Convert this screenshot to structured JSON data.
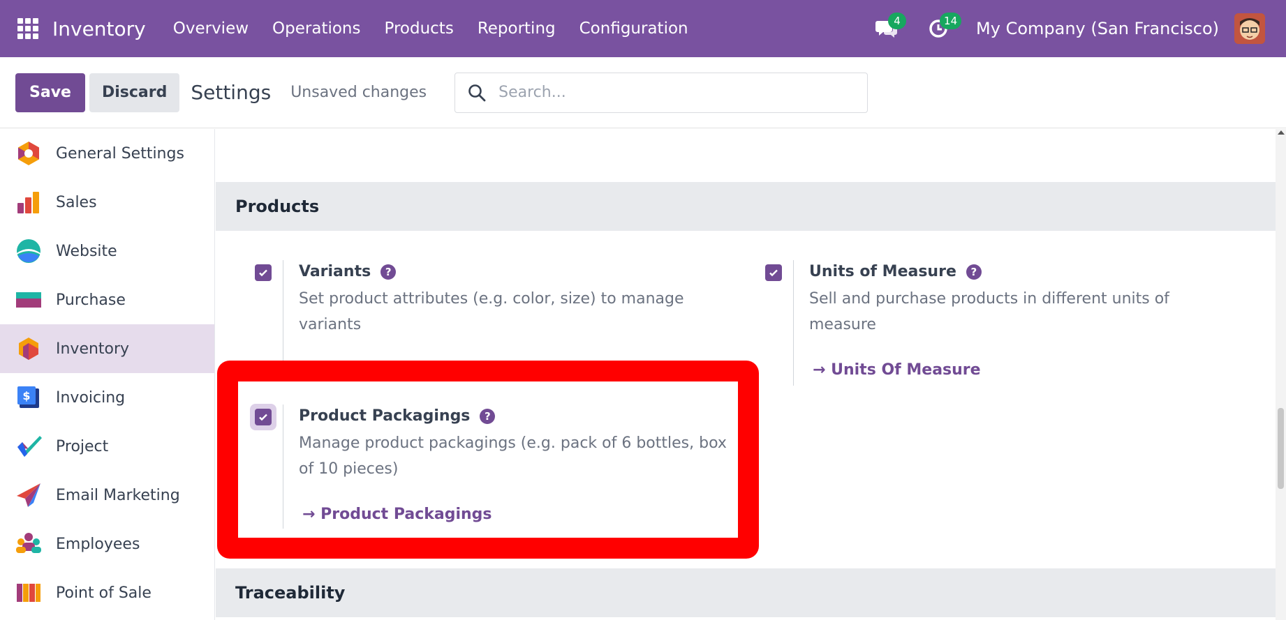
{
  "navbar": {
    "brand": "Inventory",
    "menu": [
      "Overview",
      "Operations",
      "Products",
      "Reporting",
      "Configuration"
    ],
    "messages_count": "4",
    "activities_count": "14",
    "company": "My Company (San Francisco)"
  },
  "control_panel": {
    "save_label": "Save",
    "discard_label": "Discard",
    "title": "Settings",
    "status": "Unsaved changes",
    "search_placeholder": "Search..."
  },
  "sidebar": {
    "items": [
      {
        "label": "General Settings",
        "icon": "general-settings-icon"
      },
      {
        "label": "Sales",
        "icon": "sales-icon"
      },
      {
        "label": "Website",
        "icon": "website-icon"
      },
      {
        "label": "Purchase",
        "icon": "purchase-icon"
      },
      {
        "label": "Inventory",
        "icon": "inventory-icon",
        "active": true
      },
      {
        "label": "Invoicing",
        "icon": "invoicing-icon"
      },
      {
        "label": "Project",
        "icon": "project-icon"
      },
      {
        "label": "Email Marketing",
        "icon": "email-marketing-icon"
      },
      {
        "label": "Employees",
        "icon": "employees-icon"
      },
      {
        "label": "Point of Sale",
        "icon": "point-of-sale-icon"
      }
    ]
  },
  "main": {
    "products_section": "Products",
    "traceability_section": "Traceability",
    "variants": {
      "title": "Variants",
      "desc_line1": "Set product attributes (e.g. color, size) to manage",
      "desc_line2": "variants",
      "checked": true
    },
    "uom": {
      "title": "Units of Measure",
      "desc_line1": "Sell and purchase products in different units of",
      "desc_line2": "measure",
      "link": "Units Of Measure",
      "checked": true
    },
    "packagings": {
      "title": "Product Packagings",
      "desc_line1": "Manage product packagings (e.g. pack of 6 bottles, box",
      "desc_line2": "of 10 pieces)",
      "link": "Product Packagings",
      "checked": true
    }
  },
  "colors": {
    "navbar": "#7952a0",
    "primary": "#714b94",
    "highlight": "#ff0000",
    "badge": "#17a75f"
  }
}
